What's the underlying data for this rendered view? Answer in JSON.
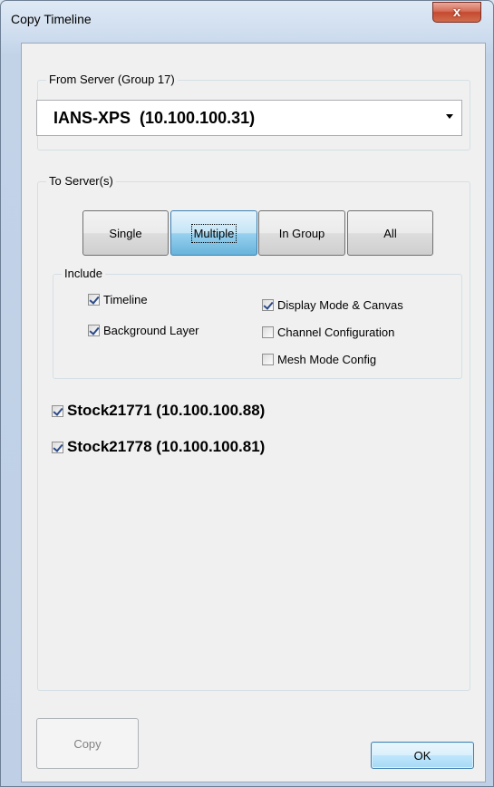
{
  "window": {
    "title": "Copy Timeline",
    "close_label": "x"
  },
  "from_server": {
    "group_label": "From Server  (Group 17)",
    "selected": "IANS-XPS  (10.100.100.31)"
  },
  "to_servers": {
    "group_label": "To Server(s)",
    "mode_buttons": [
      {
        "label": "Single",
        "active": false
      },
      {
        "label": "Multiple",
        "active": true
      },
      {
        "label": "In Group",
        "active": false
      },
      {
        "label": "All",
        "active": false
      }
    ],
    "include": {
      "label": "Include",
      "options": [
        {
          "label": "Timeline",
          "checked": true
        },
        {
          "label": "Background Layer",
          "checked": true
        },
        {
          "label": "Display Mode & Canvas",
          "checked": true
        },
        {
          "label": "Channel Configuration",
          "checked": false
        },
        {
          "label": "Mesh Mode Config",
          "checked": false
        }
      ]
    },
    "servers": [
      {
        "label": "Stock21771 (10.100.100.88)",
        "checked": true
      },
      {
        "label": "Stock21778 (10.100.100.81)",
        "checked": true
      }
    ]
  },
  "footer": {
    "copy_label": "Copy",
    "ok_label": "OK"
  },
  "colors": {
    "accent_blue": "#3c7fb1",
    "close_red": "#c54a31"
  }
}
